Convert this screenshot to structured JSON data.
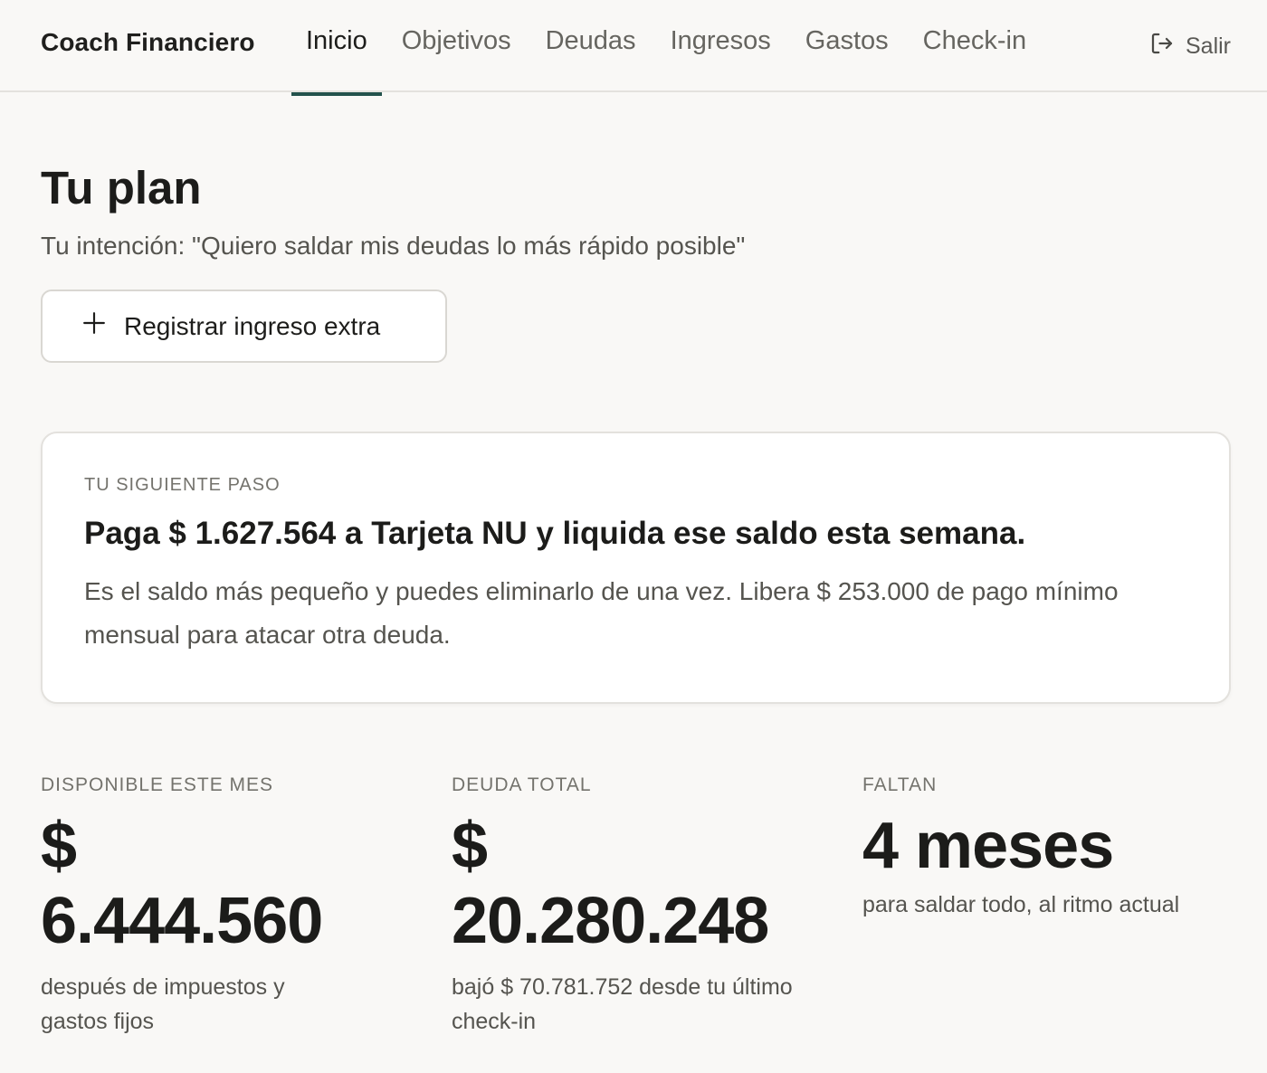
{
  "app": {
    "brand": "Coach Financiero"
  },
  "nav": {
    "items": [
      {
        "label": "Inicio",
        "active": true
      },
      {
        "label": "Objetivos",
        "active": false
      },
      {
        "label": "Deudas",
        "active": false
      },
      {
        "label": "Ingresos",
        "active": false
      },
      {
        "label": "Gastos",
        "active": false
      },
      {
        "label": "Check-in",
        "active": false
      }
    ],
    "logout_label": "Salir",
    "logout_icon": "logout-icon",
    "active_color": "#23524c"
  },
  "header": {
    "title": "Tu plan",
    "intent": "Tu intención: \"Quiero saldar mis deudas lo más rápido posible\""
  },
  "actions": {
    "extra_income_label": "Registrar ingreso extra",
    "extra_income_icon": "plus-icon"
  },
  "next_step": {
    "eyebrow": "TU SIGUIENTE PASO",
    "heading": "Paga $ 1.627.564 a Tarjeta NU y liquida ese saldo esta semana.",
    "body": "Es el saldo más pequeño y puedes eliminarlo de una vez. Libera $ 253.000 de pago mínimo mensual para atacar otra deuda."
  },
  "stats": [
    {
      "label": "DISPONIBLE ESTE MES",
      "value_line1": "$",
      "value_line2": "6.444.560",
      "note": "después de impuestos y gastos fijos"
    },
    {
      "label": "DEUDA TOTAL",
      "value_line1": "$",
      "value_line2": "20.280.248",
      "note": "bajó $ 70.781.752 desde tu último check-in"
    },
    {
      "label": "FALTAN",
      "value": "4 meses",
      "note": "para saldar todo, al ritmo actual"
    }
  ]
}
